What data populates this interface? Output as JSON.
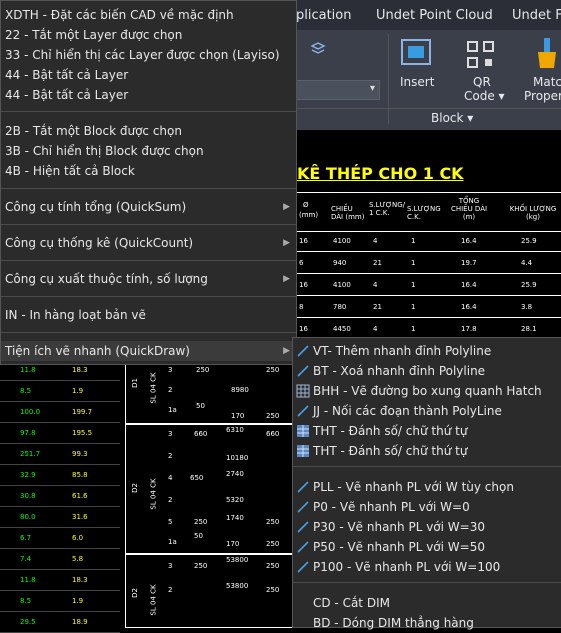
{
  "ribbon": {
    "tabs": [
      "plication",
      "Undet Point Cloud",
      "Undet Fl"
    ],
    "buttons": {
      "insert": "Insert",
      "qr_line1": "QR",
      "qr_line2": "Code ▾",
      "match_line1": "Matc",
      "match_line2": "Propert"
    },
    "block_panel": "Block ▾"
  },
  "drawing": {
    "title": "KÊ THÉP CHO 1 CK",
    "headers": [
      "Ø",
      "(mm)",
      "CHIỀU DÀI (mm)",
      "S.LƯỢNG/ 1 C.K.",
      "S.LƯỢNG C.K.",
      "TỔNG CHIỀU DÀI (m)",
      "KHỐI LƯỢNG (kg)"
    ],
    "rows": [
      [
        "16",
        "4100",
        "4",
        "1",
        "16.4",
        "25.9"
      ],
      [
        "6",
        "940",
        "21",
        "1",
        "19.7",
        "4.4"
      ],
      [
        "16",
        "4100",
        "4",
        "1",
        "16.4",
        "25.9"
      ],
      [
        "8",
        "780",
        "21",
        "1",
        "16.4",
        "3.8"
      ],
      [
        "16",
        "4450",
        "4",
        "1",
        "17.8",
        "28.1"
      ]
    ],
    "left_values": [
      [
        "11.8",
        "18.3"
      ],
      [
        "8.5",
        "1.9"
      ],
      [
        "100.0",
        "199.7"
      ],
      [
        "97.8",
        "195.5"
      ],
      [
        "251.7",
        "99.3"
      ],
      [
        "32.9",
        "85.8"
      ],
      [
        "30.8",
        "61.6"
      ],
      [
        "80.0",
        "31.6"
      ],
      [
        "6.7",
        "6.0"
      ],
      [
        "7.4",
        "5.8"
      ],
      [
        "11.8",
        "18.3"
      ],
      [
        "8.5",
        "1.9"
      ],
      [
        "29.5",
        "18.9"
      ]
    ],
    "groups": [
      "D1",
      "SL 04 CK",
      "D2",
      "SL 04 CK",
      "D2",
      "SL 04 CK"
    ],
    "marks": [
      "3",
      "2",
      "1a",
      "3",
      "2",
      "4",
      "2",
      "5",
      "2",
      "1a",
      "3",
      "2"
    ],
    "dims": [
      "250",
      "250",
      "8980",
      "50",
      "170",
      "250",
      "660",
      "6310",
      "660",
      "10180",
      "650",
      "2740",
      "5320",
      "250",
      "1740",
      "250",
      "50",
      "170",
      "250",
      "250",
      "250",
      "53800",
      "250",
      "53800",
      "250"
    ]
  },
  "menu": {
    "items": [
      "XDTH - Đặt các biến CAD về mặc định",
      "22 - Tắt một Layer được chọn",
      "33 - Chỉ hiển thị các Layer được chọn (Layiso)",
      "44 - Bật tất cả Layer",
      "44 - Bật tất cả Layer",
      "2B - Tắt một Block được chọn",
      "3B - Chỉ hiển thị Block được chọn",
      "4B - Hiện tất cả Block",
      "Công cụ tính tổng (QuickSum)",
      "Công cụ thống kê (QuickCount)",
      "Công cụ xuất thuộc tính, số lượng",
      "IN - In hàng loạt bản vẽ",
      "Tiện ích vẽ nhanh (QuickDraw)"
    ]
  },
  "submenu": {
    "items": [
      {
        "label": "VT- Thêm nhanh đỉnh Polyline",
        "icon": "polyline-add-vertex-icon"
      },
      {
        "label": "BT - Xoá nhanh đỉnh Polyline",
        "icon": "polyline-delete-vertex-icon"
      },
      {
        "label": "BHH - Vẽ đường bo xung quanh Hatch",
        "icon": "hatch-boundary-icon"
      },
      {
        "label": "JJ - Nối các đoạn thành PolyLine",
        "icon": "join-polyline-icon"
      },
      {
        "label": "THT - Đánh số/ chữ thứ tự",
        "icon": "numbering-icon"
      },
      {
        "label": "THT - Đánh số/ chữ thứ tự",
        "icon": "numbering-icon"
      },
      {
        "label": "PLL - Vẽ nhanh PL với W tùy chọn",
        "icon": "pline-icon"
      },
      {
        "label": "P0 - Vẽ nhanh PL với W=0",
        "icon": "pline-icon"
      },
      {
        "label": "P30 - Vẽ nhanh PL với W=30",
        "icon": "pline-icon"
      },
      {
        "label": "P50 - Vẽ nhanh PL với W=50",
        "icon": "pline-icon"
      },
      {
        "label": "P100 - Vẽ nhanh PL với W=100",
        "icon": "pline-icon"
      },
      {
        "label": "CD - Cắt DIM",
        "icon": ""
      },
      {
        "label": "BD - Dóng DIM thẳng hàng",
        "icon": ""
      }
    ]
  },
  "colors": {
    "accent": "#3a9be0",
    "cad_yellow": "#ffff00",
    "cad_green": "#00ff00",
    "menu_bg": "#2b2b2b"
  }
}
